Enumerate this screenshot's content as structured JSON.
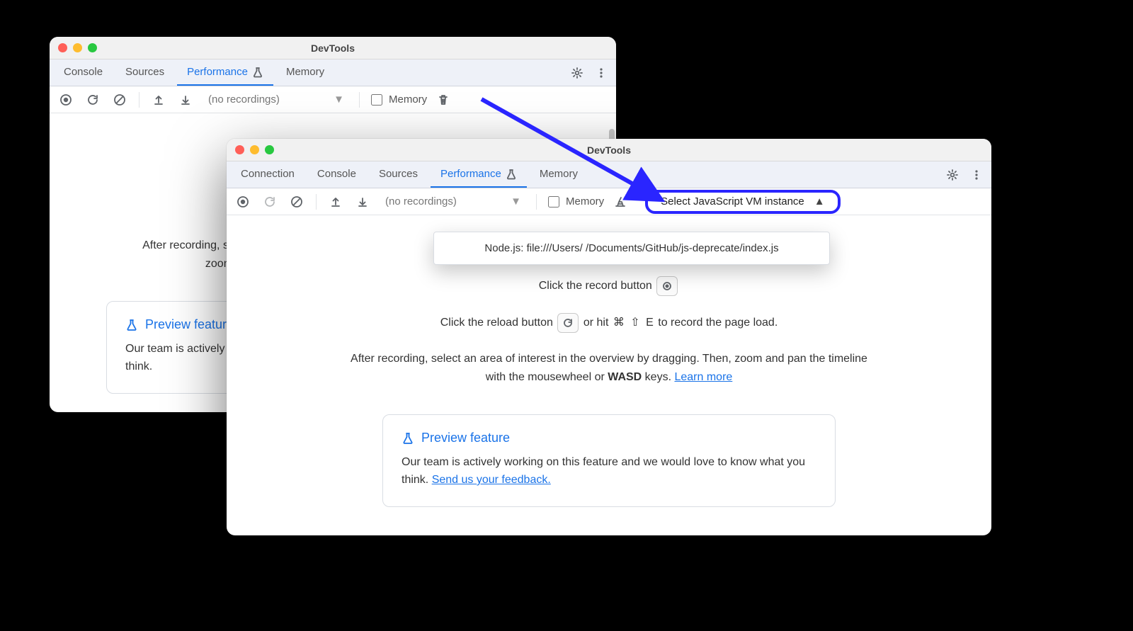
{
  "title": "DevTools",
  "tabs_back": [
    "Console",
    "Sources",
    "Performance",
    "Memory"
  ],
  "tabs_front": [
    "Connection",
    "Console",
    "Sources",
    "Performance",
    "Memory"
  ],
  "active_tab": "Performance",
  "toolbar": {
    "recordings_placeholder": "(no recordings)",
    "memory_label": "Memory"
  },
  "vm": {
    "label": "Select JavaScript VM instance",
    "options": [
      "Node.js: file:///Users/      /Documents/GitHub/js-deprecate/index.js"
    ]
  },
  "instructions": {
    "record_pre": "Click the record button ",
    "record_post_back": "",
    "reload_pre": "Click the reload button ",
    "reload_mid": " or hit ",
    "reload_key1": "⌘",
    "reload_key2": "⇧",
    "reload_key3": "E",
    "reload_post": " to record the page load.",
    "after_1": "After recording, select an area of interest in the overview by dragging. Then, zoom and pan the timeline with the mousewheel or ",
    "wasd": "WASD",
    "after_2": " keys. ",
    "learn_more": "Learn more"
  },
  "preview": {
    "heading": "Preview feature",
    "body_1": "Our team is actively working on this feature and we would love to know what you think. ",
    "link": "Send us your feedback."
  }
}
